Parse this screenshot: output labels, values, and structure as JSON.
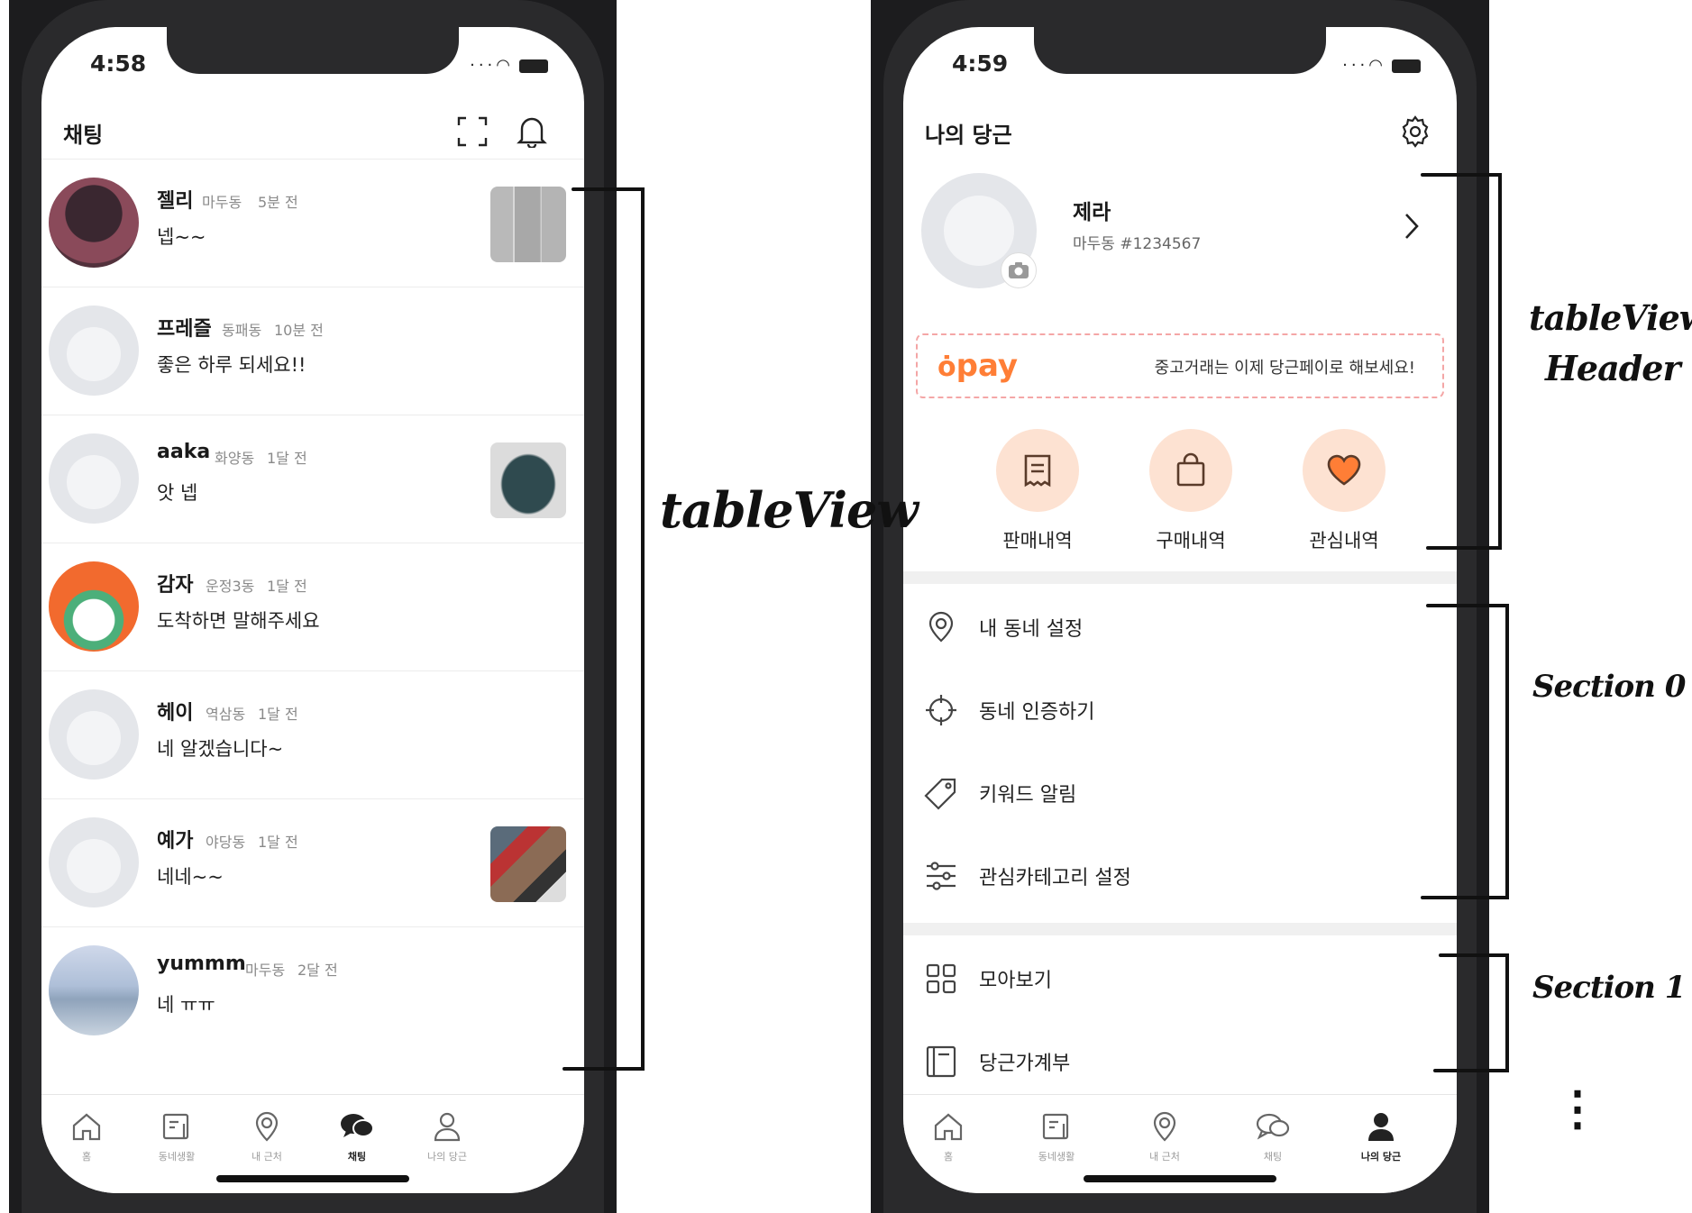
{
  "left": {
    "status_time": "4:58",
    "nav_title": "채팅",
    "chats": [
      {
        "name": "젤리",
        "location": "마두동",
        "time": "5분 전",
        "message": "넵~~"
      },
      {
        "name": "프레즐",
        "location": "동패동",
        "time": "10분 전",
        "message": "좋은 하루 되세요!!"
      },
      {
        "name": "aaka",
        "location": "화양동",
        "time": "1달 전",
        "message": "앗 넵"
      },
      {
        "name": "감자",
        "location": "운정3동",
        "time": "1달 전",
        "message": "도착하면 말해주세요"
      },
      {
        "name": "헤이",
        "location": "역삼동",
        "time": "1달 전",
        "message": "네 알겠습니다~"
      },
      {
        "name": "예가",
        "location": "야당동",
        "time": "1달 전",
        "message": "네네~~"
      },
      {
        "name": "yummm",
        "location": "마두동",
        "time": "2달 전",
        "message": "네 ㅠㅠ"
      }
    ],
    "tabs": [
      "홈",
      "동네생활",
      "내 근처",
      "채팅",
      "나의 당근"
    ]
  },
  "right": {
    "status_time": "4:59",
    "nav_title": "나의 당근",
    "profile": {
      "name": "제라",
      "sub": "마두동 #1234567"
    },
    "pay": {
      "logo": "pay",
      "text": "중고거래는 이제 당근페이로 해보세요!"
    },
    "shortcuts": [
      "판매내역",
      "구매내역",
      "관심내역"
    ],
    "section0": [
      "내 동네 설정",
      "동네 인증하기",
      "키워드 알림",
      "관심카테고리 설정"
    ],
    "section1": [
      "모아보기",
      "당근가계부"
    ],
    "tabs": [
      "홈",
      "동네생활",
      "내 근처",
      "채팅",
      "나의 당근"
    ]
  },
  "annotations": {
    "tableview": "tableView",
    "tableview_header_1": "tableView",
    "tableview_header_2": "Header",
    "section0": "Section 0",
    "section1": "Section 1",
    "ellipsis": "⋮"
  },
  "colors": {
    "accent": "#ff7e36",
    "accent_light": "#fde2d2",
    "divider": "#f0f0f0"
  }
}
